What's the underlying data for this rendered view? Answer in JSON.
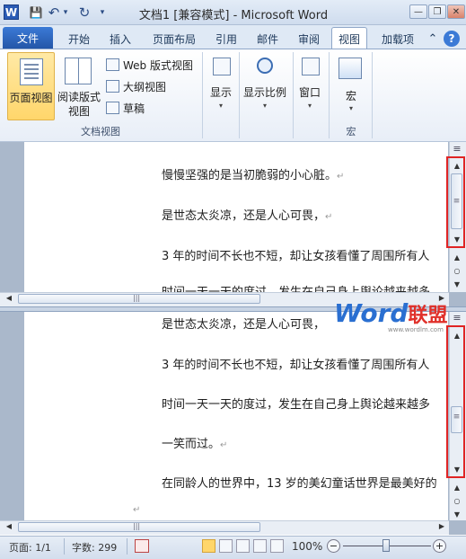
{
  "window": {
    "title": "文档1 [兼容模式] - Microsoft Word",
    "logo": "W"
  },
  "qat": {
    "save": "💾",
    "undo": "↶",
    "undo_dd": "▾",
    "redo": "↻",
    "customize": "▾"
  },
  "window_controls": {
    "help": "?",
    "minimize": "—",
    "restore": "❐",
    "close": "✕"
  },
  "tabs": [
    "文件",
    "开始",
    "插入",
    "页面布局",
    "引用",
    "邮件",
    "审阅",
    "视图",
    "加载项"
  ],
  "active_tab": "视图",
  "tab_extras": {
    "minimize_ribbon": "⌃",
    "help": "?"
  },
  "ribbon": {
    "doc_views": {
      "print_layout": "页面视图",
      "reading_line1": "阅读版式",
      "reading_line2": "视图",
      "web_layout": "Web 版式视图",
      "outline": "大纲视图",
      "draft": "草稿",
      "group_label": "文档视图"
    },
    "show": "显示",
    "zoom": "显示比例",
    "window": "窗口",
    "macro": "宏",
    "macro_group": "宏",
    "dropdown": "▾"
  },
  "pane_top": {
    "lines": [
      "慢慢坚强的是当初脆弱的小心脏。",
      "是世态太炎凉，还是人心可畏，",
      "3 年的时间不长也不短，却让女孩看懂了周围所有人",
      "时间一天一天的度过，发生在自己身上舆论越来越多"
    ]
  },
  "pane_bottom": {
    "lines": [
      "是世态太炎凉，还是人心可畏，",
      "3 年的时间不长也不短，却让女孩看懂了周围所有人",
      "时间一天一天的度过，发生在自己身上舆论越来越多",
      "一笑而过。",
      "在同龄人的世界中，13 岁的美幻童话世界是最美好的"
    ]
  },
  "para_mark": "↵",
  "scroll": {
    "up": "▲",
    "down": "▼",
    "left": "◀",
    "right": "▶",
    "grip": "≡",
    "hgrip": "|||",
    "browse": "○",
    "prev": "▲",
    "next": "▼"
  },
  "watermark": {
    "word": "Word",
    "cn": "联盟",
    "url": "www.wordlm.com"
  },
  "status": {
    "page": "页面: 1/1",
    "words": "字数: 299",
    "zoom": "100%",
    "zoom_out": "−",
    "zoom_in": "+"
  },
  "colors": {
    "accent": "#2a5bb5",
    "highlight": "#ffd66b",
    "redbox": "#e02424"
  }
}
